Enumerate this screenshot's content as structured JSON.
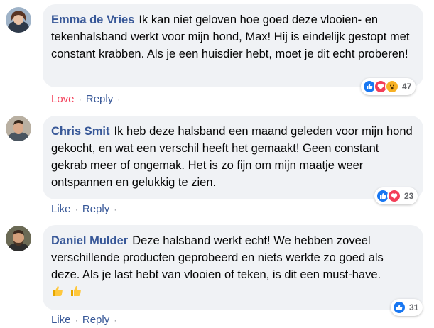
{
  "comments": [
    {
      "author": "Emma de Vries",
      "text": "Ik kan niet geloven hoe goed deze vlooien- en tekenhalsband werkt voor mijn hond, Max! Hij is eindelijk gestopt met constant krabben. Als je een huisdier hebt, moet je dit echt proberen!",
      "reaction_label": "Love",
      "reply_label": "Reply",
      "reaction_icons": [
        "like-icon",
        "love-icon",
        "wow-icon"
      ],
      "reaction_count": "47"
    },
    {
      "author": "Chris Smit",
      "text": "Ik heb deze halsband een maand geleden voor mijn hond gekocht, en wat een verschil heeft het gemaakt! Geen constant gekrab meer of ongemak. Het is zo fijn om mijn maatje weer ontspannen en gelukkig te zien.",
      "reaction_label": "Like",
      "reply_label": "Reply",
      "reaction_icons": [
        "like-icon",
        "love-icon"
      ],
      "reaction_count": "23"
    },
    {
      "author": "Daniel Mulder",
      "text": "Deze halsband werkt echt! We hebben zoveel verschillende producten geprobeerd en niets werkte zo goed als deze. Als je last hebt van vlooien of teken, is dit een must-have.",
      "emoji": [
        "thumbs-up-emoji",
        "thumbs-up-emoji"
      ],
      "reaction_label": "Like",
      "reply_label": "Reply",
      "reaction_icons": [
        "like-icon"
      ],
      "reaction_count": "31"
    }
  ],
  "colors": {
    "author": "#385898",
    "link": "#385898",
    "love": "#f33e58",
    "bubble": "#f0f2f5",
    "like_reaction": "#1877f2",
    "wow_reaction": "#f7b125"
  }
}
